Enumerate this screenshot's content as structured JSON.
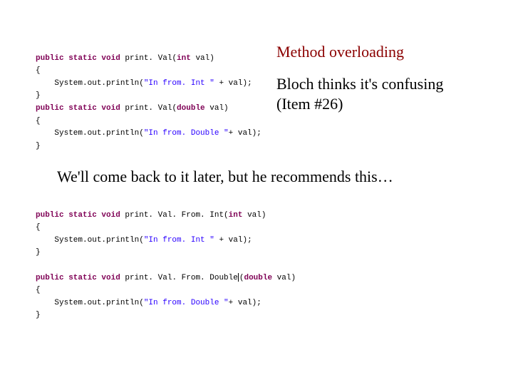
{
  "title": "Method overloading",
  "subtitle_line1": "Bloch thinks it's confusing",
  "subtitle_line2": "(Item #26)",
  "midtext": "We'll come back to it later, but he recommends this…",
  "code1": {
    "m1_sig_pre": "public static void",
    "m1_sig_name": " print. Val(",
    "m1_sig_type": "int",
    "m1_sig_post": " val)",
    "m1_open": "{",
    "m1_body_pre": "    System.out.println(",
    "m1_body_str": "\"In from. Int \"",
    "m1_body_post": " + val);",
    "m1_close": "}",
    "m2_sig_pre": "public static void",
    "m2_sig_name": " print. Val(",
    "m2_sig_type": "double",
    "m2_sig_post": " val)",
    "m2_open": "{",
    "m2_body_pre": "    System.out.println(",
    "m2_body_str": "\"In from. Double \"",
    "m2_body_post": "+ val);",
    "m2_close": "}"
  },
  "code2": {
    "m1_sig_pre": "public static void",
    "m1_sig_name": " print. Val. From. Int(",
    "m1_sig_type": "int",
    "m1_sig_post": " val)",
    "m1_open": "{",
    "m1_body_pre": "    System.out.println(",
    "m1_body_str": "\"In from. Int \"",
    "m1_body_post": " + val);",
    "m1_close": "}",
    "blank": "",
    "m2_sig_pre": "public static void",
    "m2_sig_name": " print. Val. From. Double",
    "m2_sig_paren": "(",
    "m2_sig_type": "double",
    "m2_sig_post": " val)",
    "m2_open": "{",
    "m2_body_pre": "    System.out.println(",
    "m2_body_str": "\"In from. Double \"",
    "m2_body_post": "+ val);",
    "m2_close": "}"
  }
}
